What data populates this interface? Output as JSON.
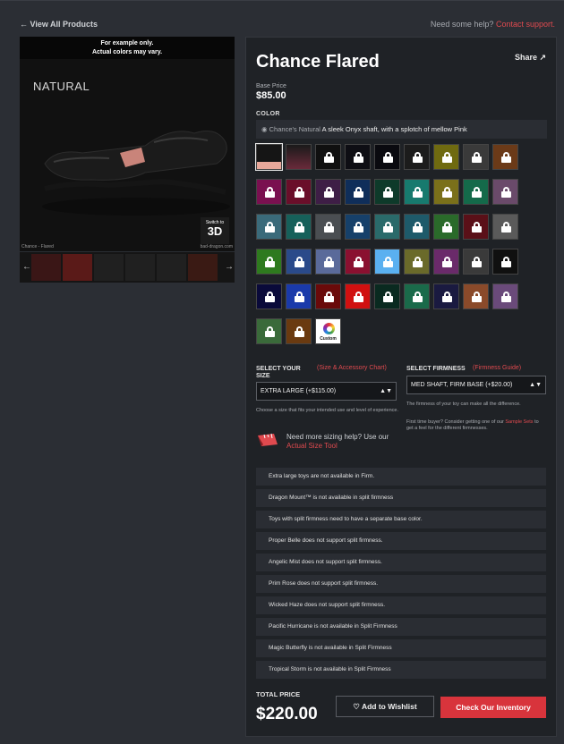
{
  "nav": {
    "back_label": "← View All Products",
    "help_text": "Need some help?",
    "help_link": "Contact support."
  },
  "image": {
    "banner_line1": "For example only.",
    "banner_line2": "Actual colors may vary.",
    "color_name": "NATURAL",
    "switch_small": "Switch to",
    "switch_big": "3D",
    "caption_left": "Chance - Flared",
    "caption_right": "bad-dragon.com",
    "prev_icon": "←",
    "next_icon": "→"
  },
  "product": {
    "title": "Chance Flared",
    "share_label": "Share ↗",
    "base_price_label": "Base Price",
    "base_price": "$85.00"
  },
  "color": {
    "label": "COLOR",
    "selected_name": "Chance's Natural",
    "selected_desc": "A sleek Onyx shaft, with a splotch of mellow Pink",
    "custom_label": "Custom"
  },
  "swatch_colors": [
    [
      "#1a1a1a",
      "#5a1a2e",
      "#101010",
      "#0e0e14",
      "#0a0a0f",
      "#1c1c1c",
      "#6f6a10",
      "#3a3a3a",
      "#6b3a18"
    ],
    [
      "#7a1050",
      "#6a0e2a",
      "#3e1e46",
      "#0f2e5a",
      "#0e3a2a",
      "#177a6e",
      "#7a701a",
      "#146a4a",
      "#6a4a6a"
    ],
    [
      "#3a6a7a",
      "#16605a",
      "#4a4e52",
      "#16406a",
      "#2a6a6a",
      "#1e5a6a",
      "#2a6a2a",
      "#5a1018",
      "#5a5a5a"
    ],
    [
      "#2e7a1e",
      "#2a4a8a",
      "#5a6a9a",
      "#8a1030",
      "#5ab0f0",
      "#6a6a2a",
      "#6a2a6a",
      "#3a3a3a",
      "#101010"
    ],
    [
      "#0a0a3a",
      "#1a3aaa",
      "#6a0a0a",
      "#d01010",
      "#0a2a20",
      "#1a6a4a",
      "#1a1a40",
      "#8a4a2a",
      "#6a4a7a"
    ],
    [
      "#3a6a3a",
      "#6a3a10"
    ]
  ],
  "size": {
    "label": "SELECT YOUR SIZE",
    "guide": "(Size & Accessory Chart)",
    "value": "EXTRA LARGE (+$115.00)",
    "note": "Choose a size that fits your intended use and level of experience.",
    "help_text": "Need more sizing help? Use our",
    "help_link": "Actual Size Tool"
  },
  "firmness": {
    "label": "SELECT FIRMNESS",
    "guide": "(Firmness Guide)",
    "value": "MED SHAFT, FIRM BASE (+$20.00)",
    "note1": "The firmness of your toy can make all the difference.",
    "note2a": "First time buyer? Consider getting one of our",
    "note2_link": "Sample Sets",
    "note2b": "to get a feel for the different firmnesses."
  },
  "warnings": [
    "Extra large toys are not available in Firm.",
    "Dragon Mount™ is not available in split firmness",
    "Toys with split firmness need to have a separate base color.",
    "Proper Belle does not support split firmness.",
    "Angelic Mist does not support split firmness.",
    "Prim Rose does not support split firmness.",
    "Wicked Haze does not support split firmness.",
    "Pacific Hurricane is not available in Split Firmness",
    "Magic Butterfly is not available in Split Firmness",
    "Tropical Storm is not available in Split Firmness"
  ],
  "total": {
    "label": "TOTAL PRICE",
    "value": "$220.00",
    "wishlist_label": "Add to Wishlist",
    "inventory_label": "Check Our Inventory"
  }
}
